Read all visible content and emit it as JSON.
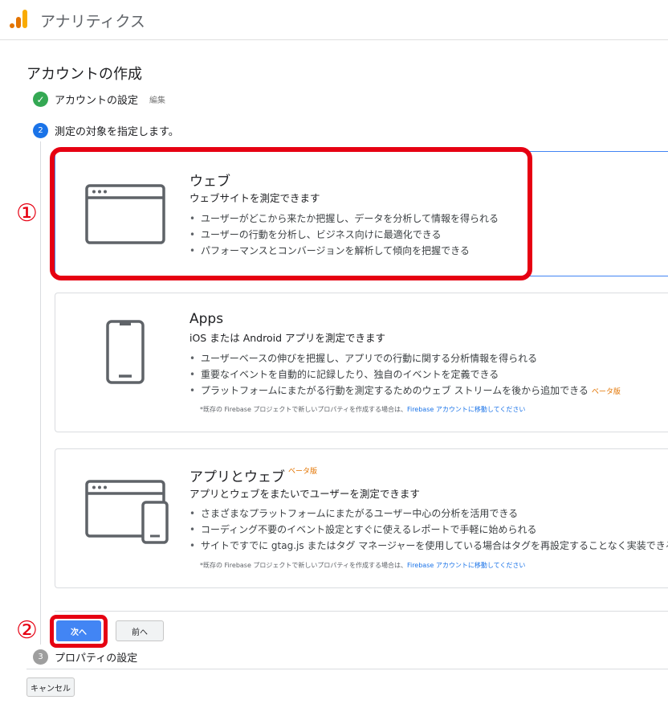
{
  "app": {
    "title": "アナリティクス"
  },
  "page": {
    "title": "アカウントの作成"
  },
  "steps": [
    {
      "label": "アカウントの設定",
      "edit": "編集",
      "status": "done"
    },
    {
      "number": "2",
      "label": "測定の対象を指定します。",
      "status": "active"
    },
    {
      "number": "3",
      "label": "プロパティの設定",
      "status": "pending"
    }
  ],
  "cards": [
    {
      "title": "ウェブ",
      "subtitle": "ウェブサイトを測定できます",
      "features": [
        "ユーザーがどこから来たか把握し、データを分析して情報を得られる",
        "ユーザーの行動を分析し、ビジネス向けに最適化できる",
        "パフォーマンスとコンバージョンを解析して傾向を把握できる"
      ],
      "icon": "browser-window-icon"
    },
    {
      "title": "Apps",
      "subtitle": "iOS または Android アプリを測定できます",
      "features": [
        "ユーザーベースの伸びを把握し、アプリでの行動に関する分析情報を得られる",
        "重要なイベントを自動的に記録したり、独自のイベントを定義できる",
        "プラットフォームにまたがる行動を測定するためのウェブ ストリームを後から追加できる"
      ],
      "feature_badge": "ベータ版",
      "note_prefix": "*既存の Firebase プロジェクトで新しいプロパティを作成する場合は、",
      "note_link": "Firebase アカウントに移動してください",
      "icon": "smartphone-icon"
    },
    {
      "title": "アプリとウェブ",
      "title_badge": "ベータ版",
      "subtitle": "アプリとウェブをまたいでユーザーを測定できます",
      "features": [
        "さまざまなプラットフォームにまたがるユーザー中心の分析を活用できる",
        "コーディング不要のイベント設定とすぐに使えるレポートで手軽に始められる",
        "サイトですでに gtag.js またはタグ マネージャーを使用している場合はタグを再設定することなく実装できる"
      ],
      "note_prefix": "*既存の Firebase プロジェクトで新しいプロパティを作成する場合は、",
      "note_link": "Firebase アカウントに移動してください",
      "icon": "browser-and-phone-icon"
    }
  ],
  "buttons": {
    "next": "次へ",
    "prev": "前へ",
    "cancel": "キャンセル"
  },
  "annotations": {
    "marker1": "①",
    "marker2": "②"
  },
  "colors": {
    "highlight": "#e60012",
    "primary": "#4285f4",
    "success": "#34a853",
    "beta": "#e37400"
  }
}
